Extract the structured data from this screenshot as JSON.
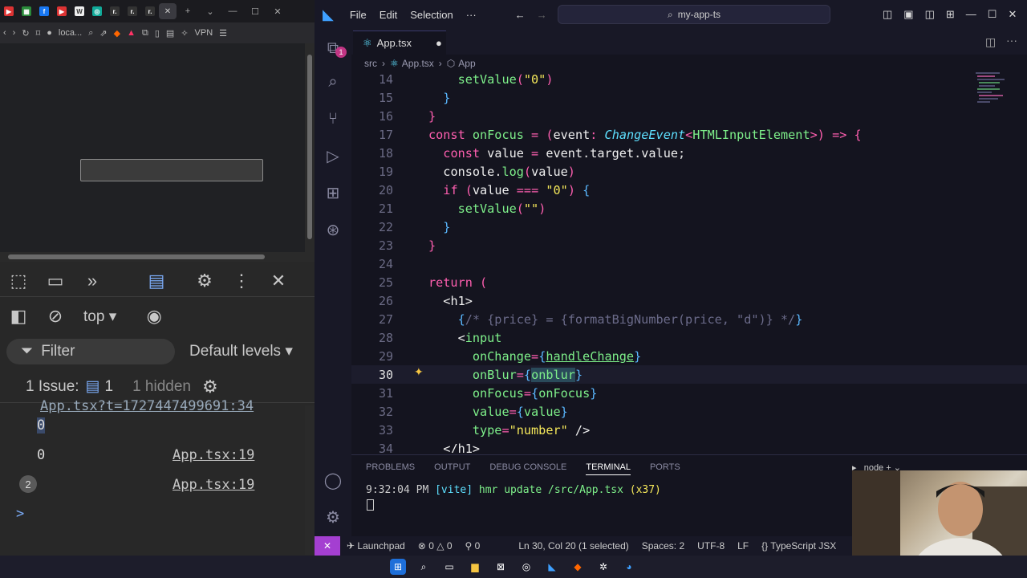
{
  "browser": {
    "address": "loca...",
    "vpn_label": "VPN",
    "devtools": {
      "context": "top",
      "filter_label": "Filter",
      "levels_label": "Default levels",
      "issues_label": "1 Issue:",
      "issues_count": "1",
      "hidden_label": "1 hidden",
      "console": [
        {
          "text": "App.tsx?t=1727447499691:34",
          "kind": "link"
        },
        {
          "text": "0",
          "kind": "value"
        },
        {
          "text": "0",
          "kind": "value",
          "source": "App.tsx:19"
        },
        {
          "badge": "2",
          "source": "App.tsx:19"
        }
      ],
      "prompt": ">"
    }
  },
  "vscode": {
    "menu": [
      "File",
      "Edit",
      "Selection",
      "···"
    ],
    "search": "my-app-ts",
    "tab": "App.tsx",
    "scm_badge": "1",
    "breadcrumb": [
      "src",
      "App.tsx",
      "App"
    ],
    "lines": [
      {
        "n": "14"
      },
      {
        "n": "15"
      },
      {
        "n": "16"
      },
      {
        "n": "17"
      },
      {
        "n": "18"
      },
      {
        "n": "19"
      },
      {
        "n": "20"
      },
      {
        "n": "21"
      },
      {
        "n": "22"
      },
      {
        "n": "23"
      },
      {
        "n": "24"
      },
      {
        "n": "25"
      },
      {
        "n": "26"
      },
      {
        "n": "27"
      },
      {
        "n": "28"
      },
      {
        "n": "29"
      },
      {
        "n": "30"
      },
      {
        "n": "31"
      },
      {
        "n": "32"
      },
      {
        "n": "33"
      },
      {
        "n": "34"
      }
    ],
    "panel": {
      "tabs": [
        "PROBLEMS",
        "OUTPUT",
        "DEBUG CONSOLE",
        "TERMINAL",
        "PORTS"
      ],
      "active": "TERMINAL",
      "shell": "node",
      "terminal_time": "9:32:04 PM",
      "terminal_tag": "[vite]",
      "terminal_msg": "hmr update /src/App.tsx",
      "terminal_count": "(x37)"
    },
    "status": {
      "launchpad": "Launchpad",
      "errors": "0",
      "warnings": "0",
      "ports": "0",
      "position": "Ln 30, Col 20 (1 selected)",
      "spaces": "Spaces: 2",
      "encoding": "UTF-8",
      "eol": "LF",
      "language": "TypeScript JSX"
    }
  },
  "colors": {
    "accent": "#a43fd1",
    "editor_bg": "#14141f",
    "keyword": "#ff5fb0",
    "function": "#7ef08a",
    "string": "#f5e85a",
    "type": "#5ee0ff"
  }
}
